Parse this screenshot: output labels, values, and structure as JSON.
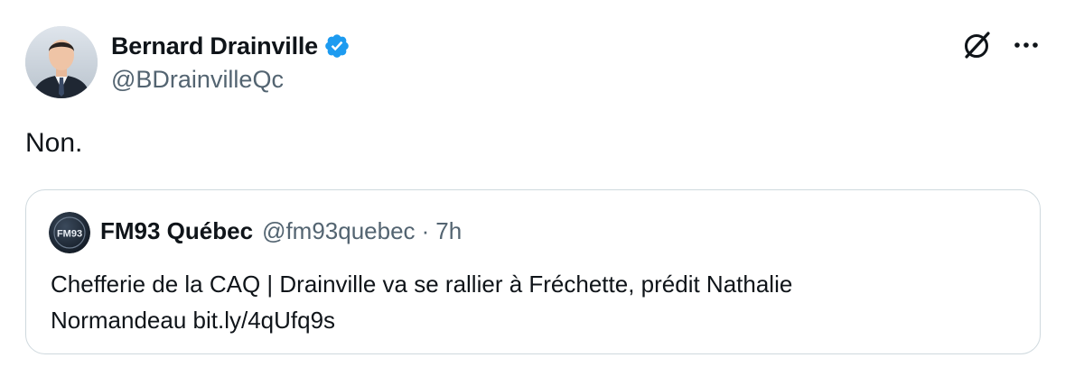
{
  "author": {
    "name": "Bernard Drainville",
    "handle": "@BDrainvilleQc",
    "verified": true,
    "verified_color": "#1d9bf0"
  },
  "tweet": {
    "text": "Non."
  },
  "actions": {
    "grok_icon": "grok-icon",
    "more_icon": "more-options-icon"
  },
  "quote": {
    "name": "FM93 Québec",
    "handle": "@fm93quebec",
    "separator": "·",
    "time": "7h",
    "avatar_text": "FM93",
    "text_line1": "Chefferie de la CAQ | Drainville va se rallier à Fréchette, prédit Nathalie",
    "text_line2": "Normandeau bit.ly/4qUfq9s"
  }
}
